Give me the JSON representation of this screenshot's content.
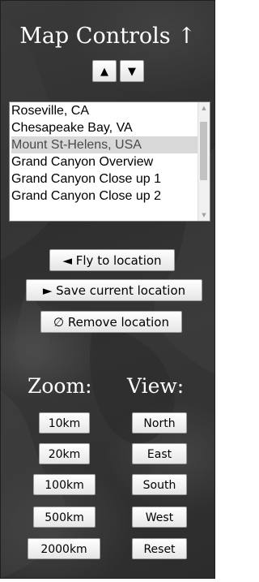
{
  "header": {
    "title": "Map Controls ↑"
  },
  "order_buttons": {
    "up_label": "▲",
    "down_label": "▼"
  },
  "locations": {
    "items": [
      {
        "label": "Roseville, CA"
      },
      {
        "label": "Chesapeake Bay, VA"
      },
      {
        "label": "Mount St-Helens, USA"
      },
      {
        "label": "Grand Canyon Overview"
      },
      {
        "label": "Grand Canyon Close up 1"
      },
      {
        "label": "Grand Canyon Close up 2"
      }
    ],
    "selected_index": 2,
    "scroll_up_glyph": "▲",
    "scroll_down_glyph": "▼"
  },
  "actions": {
    "fly_label": "◄ Fly to location",
    "save_label": "► Save current location",
    "remove_label": "∅ Remove location"
  },
  "zoom": {
    "label": "Zoom:",
    "options": [
      "10km",
      "20km",
      "100km",
      "500km",
      "2000km"
    ]
  },
  "view": {
    "label": "View:",
    "options": [
      "North",
      "East",
      "South",
      "West",
      "Reset"
    ]
  },
  "colors": {
    "panel_background": "#333333",
    "button_background": "#f0f0f0",
    "selected_item": "#d9d9d9",
    "title_text": "#ffffff"
  }
}
